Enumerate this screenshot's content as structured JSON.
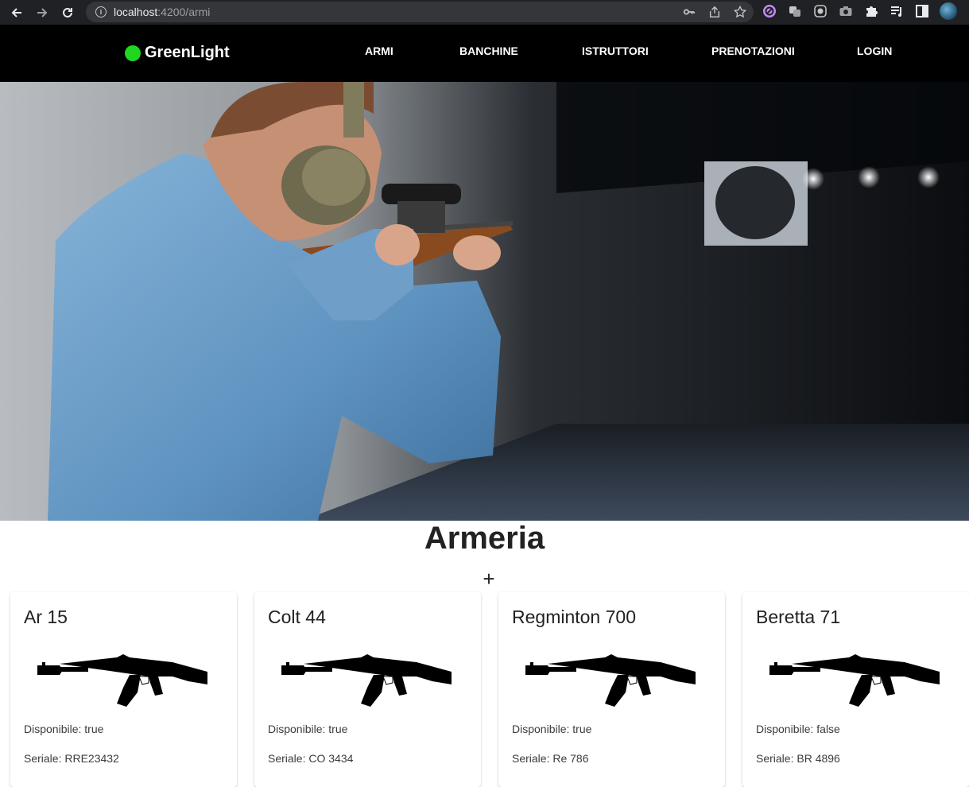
{
  "browser": {
    "url_host": "localhost",
    "url_path": ":4200/armi"
  },
  "navbar": {
    "brand": "GreenLight",
    "brand_color": "#1ed71e",
    "items": [
      {
        "label": "ARMI"
      },
      {
        "label": "BANCHINE"
      },
      {
        "label": "ISTRUTTORI"
      },
      {
        "label": "PRENOTAZIONI"
      },
      {
        "label": "LOGIN"
      }
    ]
  },
  "main": {
    "title": "Armeria",
    "add_label": "+",
    "cards": [
      {
        "name": "Ar 15",
        "disponibile": "Disponibile: true",
        "seriale": "Seriale: RRE23432"
      },
      {
        "name": "Colt 44",
        "disponibile": "Disponibile: true",
        "seriale": "Seriale: CO 3434"
      },
      {
        "name": "Regminton 700",
        "disponibile": "Disponibile: true",
        "seriale": "Seriale: Re 786"
      },
      {
        "name": "Beretta 71",
        "disponibile": "Disponibile: false",
        "seriale": "Seriale: BR 4896"
      }
    ]
  }
}
